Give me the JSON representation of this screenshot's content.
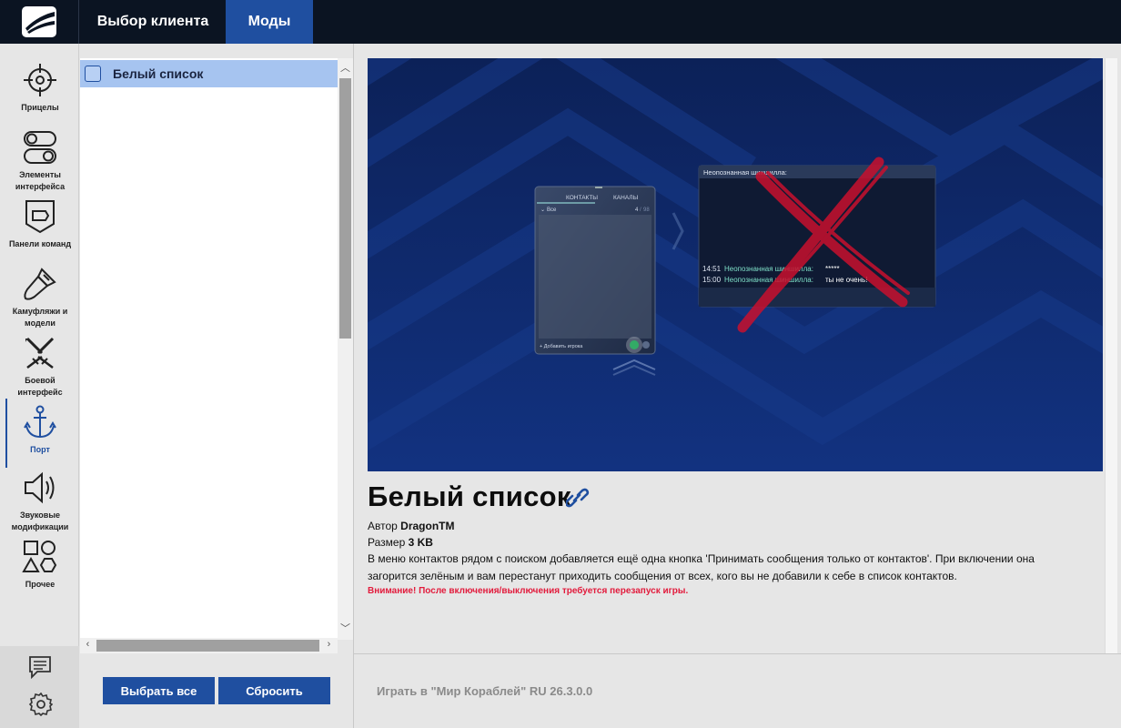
{
  "header": {
    "tabs": [
      {
        "label": "Выбор клиента",
        "active": false
      },
      {
        "label": "Моды",
        "active": true
      }
    ]
  },
  "sidebar": {
    "categories": [
      {
        "label": "Прицелы",
        "icon": "crosshair-icon"
      },
      {
        "label": "Элементы интерфейса",
        "icon": "toggles-icon"
      },
      {
        "label": "Панели команд",
        "icon": "team-panel-icon"
      },
      {
        "label": "Камуфляжи и модели",
        "icon": "paintbrush-icon"
      },
      {
        "label": "Боевой интерфейс",
        "icon": "crossed-swords-icon"
      },
      {
        "label": "Порт",
        "icon": "anchor-icon",
        "active": true
      },
      {
        "label": "Звуковые модификации",
        "icon": "speaker-icon"
      },
      {
        "label": "Прочее",
        "icon": "shapes-icon"
      }
    ],
    "bottom_icons": [
      "chat-icon",
      "gear-icon"
    ]
  },
  "mod_list": {
    "items": [
      {
        "label": "Белый список",
        "checked": false,
        "selected": true
      }
    ],
    "select_all_label": "Выбрать все",
    "reset_label": "Сбросить"
  },
  "details": {
    "title": "Белый список",
    "author_label": "Автор",
    "author": "DragonTM",
    "size_label": "Размер",
    "size": "3 KB",
    "description": "В меню контактов рядом с поиском добавляется ещё одна кнопка 'Принимать сообщения только от контактов'. При включении она загорится зелёным и вам перестанут приходить сообщения от всех, кого вы не добавили к себе в список контактов.",
    "warning": "Внимание! После включения/выключения требуется перезапуск игры."
  },
  "preview": {
    "contacts_tab": "КОНТАКТЫ",
    "channels_tab": "КАНАЛЫ",
    "group_label": "Все",
    "count": "4",
    "count_total": "98",
    "add_player": "+ Добавить игрока",
    "chat_title": "Неопознанная шиншилла:",
    "messages": [
      {
        "time": "14:51",
        "sender": "Неопознанная шиншилла:",
        "text": "*****"
      },
      {
        "time": "15:00",
        "sender": "Неопознанная шиншилла:",
        "text": "ты не очень!"
      }
    ]
  },
  "footer": {
    "play_label": "Играть в \"Мир Кораблей\" RU 26.3.0.0"
  },
  "colors": {
    "accent": "#1f4fa0",
    "topbar": "#0b1422",
    "selected_row": "#a6c4f0",
    "warning": "#e21b3c",
    "preview_bg": "#0f2a6a"
  }
}
